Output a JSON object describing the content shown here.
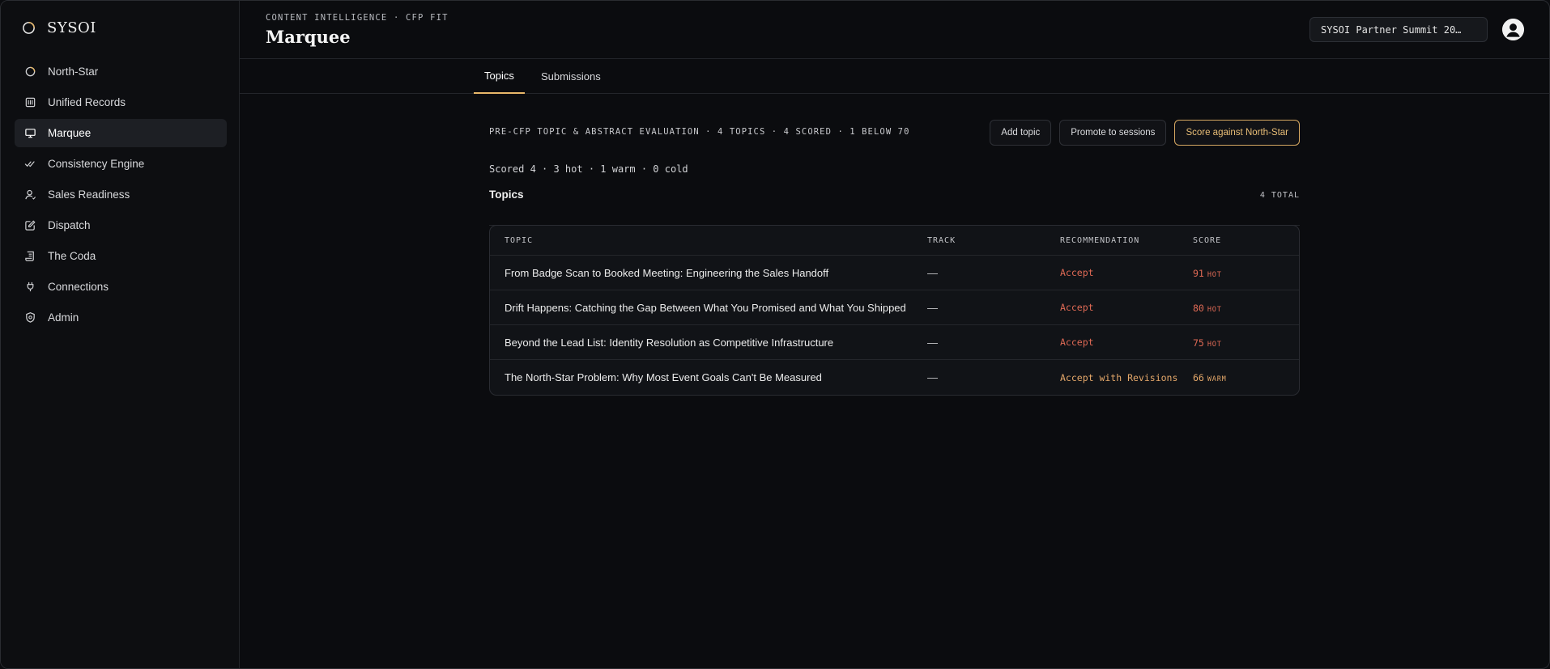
{
  "brand": {
    "name": "SYSOI",
    "logo_icon": "brand-ring-icon"
  },
  "sidebar": {
    "items": [
      {
        "label": "North-Star",
        "icon": "north-star-icon",
        "active": false
      },
      {
        "label": "Unified Records",
        "icon": "records-icon",
        "active": false
      },
      {
        "label": "Marquee",
        "icon": "presentation-icon",
        "active": true
      },
      {
        "label": "Consistency Engine",
        "icon": "double-check-icon",
        "active": false
      },
      {
        "label": "Sales Readiness",
        "icon": "user-icon",
        "active": false
      },
      {
        "label": "Dispatch",
        "icon": "edit-icon",
        "active": false
      },
      {
        "label": "The Coda",
        "icon": "scroll-icon",
        "active": false
      },
      {
        "label": "Connections",
        "icon": "plug-icon",
        "active": false
      },
      {
        "label": "Admin",
        "icon": "shield-icon",
        "active": false
      }
    ]
  },
  "header": {
    "eyebrow": "CONTENT INTELLIGENCE · CFP FIT",
    "title": "Marquee",
    "event_select": "SYSOI Partner Summit 20…",
    "avatar_icon": "user-avatar-icon"
  },
  "tabs": [
    {
      "label": "Topics",
      "active": true
    },
    {
      "label": "Submissions",
      "active": false
    }
  ],
  "main": {
    "meta_line": "PRE-CFP TOPIC & ABSTRACT EVALUATION · 4 TOPICS · 4 SCORED · 1 BELOW 70",
    "actions": {
      "add_topic": "Add topic",
      "promote": "Promote to sessions",
      "score": "Score against North-Star"
    },
    "scored_line": "Scored 4 · 3 hot · 1 warm · 0 cold",
    "section_title": "Topics",
    "section_count": "4 TOTAL",
    "columns": {
      "topic": "TOPIC",
      "track": "TRACK",
      "recommendation": "RECOMMENDATION",
      "score": "SCORE"
    },
    "rows": [
      {
        "topic": "From Badge Scan to Booked Meeting: Engineering the Sales Handoff",
        "track": "—",
        "recommendation": "Accept",
        "score": "91",
        "tier": "HOT"
      },
      {
        "topic": "Drift Happens: Catching the Gap Between What You Promised and What You Shipped",
        "track": "—",
        "recommendation": "Accept",
        "score": "80",
        "tier": "HOT"
      },
      {
        "topic": "Beyond the Lead List: Identity Resolution as Competitive Infrastructure",
        "track": "—",
        "recommendation": "Accept",
        "score": "75",
        "tier": "HOT"
      },
      {
        "topic": "The North-Star Problem: Why Most Event Goals Can't Be Measured",
        "track": "—",
        "recommendation": "Accept with Revisions",
        "score": "66",
        "tier": "WARM"
      }
    ]
  },
  "colors": {
    "accent": "#e8b86a",
    "hot": "#e06a55",
    "warm": "#e5a86a",
    "background": "#0b0c0f"
  }
}
